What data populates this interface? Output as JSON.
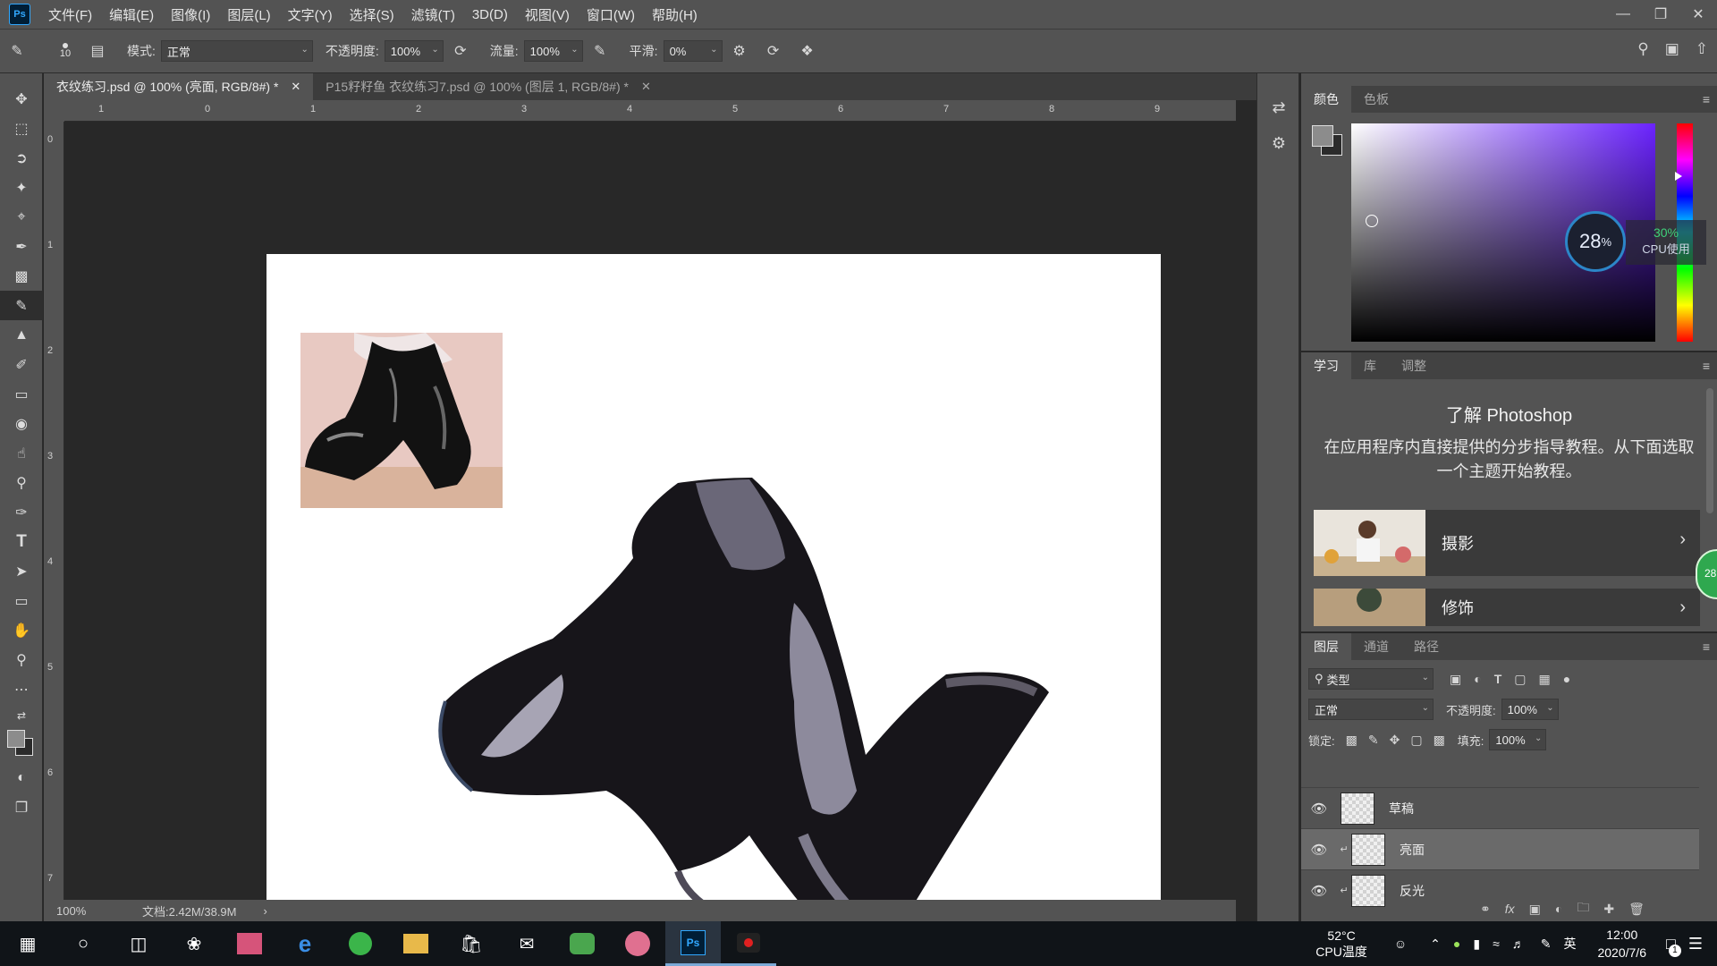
{
  "app": {
    "logo_text": "Ps",
    "menu": [
      "文件(F)",
      "编辑(E)",
      "图像(I)",
      "图层(L)",
      "文字(Y)",
      "选择(S)",
      "滤镜(T)",
      "3D(D)",
      "视图(V)",
      "窗口(W)",
      "帮助(H)"
    ]
  },
  "options": {
    "brush_size": "10",
    "mode_label": "模式:",
    "mode_value": "正常",
    "opacity_label": "不透明度:",
    "opacity_value": "100%",
    "flow_label": "流量:",
    "flow_value": "100%",
    "smooth_label": "平滑:",
    "smooth_value": "0%"
  },
  "document": {
    "tabs": [
      {
        "label": "衣纹练习.psd @ 100% (亮面, RGB/8#) *",
        "active": true
      },
      {
        "label": "P15籽籽鱼 衣纹练习7.psd @ 100% (图层 1, RGB/8#) *",
        "active": false
      }
    ],
    "ruler_h_labels": [
      "1",
      "0",
      "1",
      "2",
      "3",
      "4",
      "5",
      "6",
      "7",
      "8",
      "9"
    ],
    "ruler_v_labels": [
      "0",
      "1",
      "2",
      "3",
      "4",
      "5",
      "6",
      "7"
    ],
    "zoom": "100%",
    "doc_info": "文档:2.42M/38.9M"
  },
  "color_panel": {
    "tabs": [
      "颜色",
      "色板"
    ],
    "fg_color": "#8c8c8c",
    "bg_color": "#2b2b2b"
  },
  "cpu_widget": {
    "gauge_value": "28",
    "gauge_unit": "%",
    "usage_value": "30%",
    "usage_label": "CPU使用"
  },
  "learn_panel": {
    "tabs": [
      "学习",
      "库",
      "调整"
    ],
    "title": "了解 Photoshop",
    "description": "在应用程序内直接提供的分步指导教程。从下面选取一个主题开始教程。",
    "cards": [
      "摄影",
      "修饰"
    ]
  },
  "layers_panel": {
    "tabs": [
      "图层",
      "通道",
      "路径"
    ],
    "filter_label": "类型",
    "blend_mode": "正常",
    "opacity_label": "不透明度:",
    "opacity_value": "100%",
    "lock_label": "锁定:",
    "fill_label": "填充:",
    "fill_value": "100%",
    "layers": [
      {
        "name": "草稿",
        "visible": true,
        "selected": false,
        "clipped": false
      },
      {
        "name": "亮面",
        "visible": true,
        "selected": true,
        "clipped": true
      },
      {
        "name": "反光",
        "visible": true,
        "selected": false,
        "clipped": true
      }
    ],
    "footer_icons": [
      "link-icon",
      "fx-icon",
      "mask-icon",
      "adjustment-icon",
      "folder-icon",
      "new-layer-icon",
      "trash-icon"
    ]
  },
  "side_badge": "28",
  "taskbar": {
    "cpu_temp": "52°C",
    "cpu_temp_label": "CPU温度",
    "ime": "英",
    "time": "12:00",
    "date": "2020/7/6",
    "notification_count": "1"
  }
}
